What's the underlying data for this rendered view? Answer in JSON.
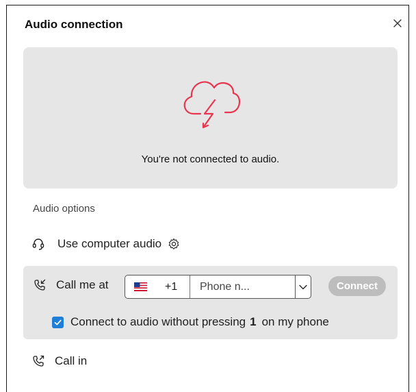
{
  "dialog": {
    "title": "Audio connection",
    "status_text": "You're not connected to audio.",
    "section_label": "Audio options",
    "status_color": "#e8364f",
    "accent_color": "#1f7fd8"
  },
  "options": {
    "computer_audio_label": "Use computer audio",
    "call_me_label": "Call me at",
    "country_code": "+1",
    "country_flag": "us-flag-icon",
    "phone_placeholder": "Phone n...",
    "phone_value": "",
    "connect_label": "Connect",
    "auto_connect_prefix": "Connect to audio without pressing",
    "auto_connect_key": "1",
    "auto_connect_suffix": "on my phone",
    "auto_connect_checked": true,
    "call_in_label": "Call in"
  },
  "icons": {
    "close": "close-icon",
    "status": "cloud-lightning-icon",
    "computer_audio": "headset-icon",
    "settings": "gear-icon",
    "call_me": "phone-incoming-icon",
    "call_in": "phone-outgoing-icon",
    "dropdown": "chevron-down-icon"
  }
}
